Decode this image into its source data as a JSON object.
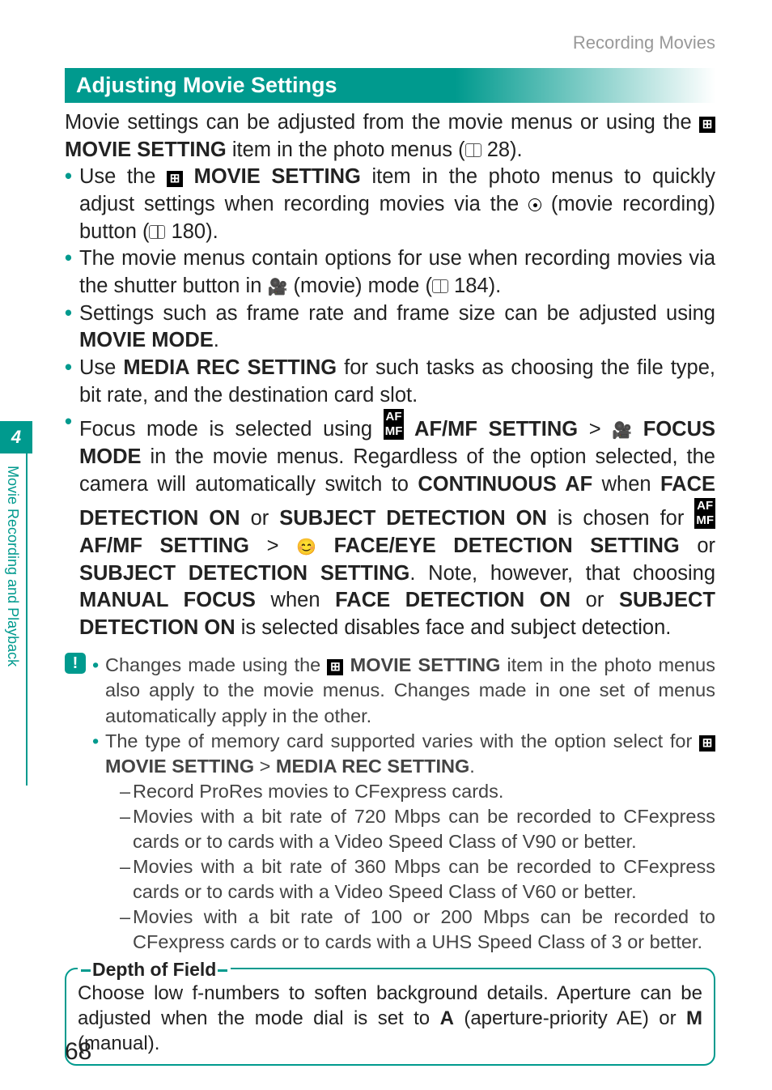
{
  "header": {
    "section": "Recording Movies"
  },
  "title": "Adjusting Movie Settings",
  "intro_a": "Movie settings can be adjusted from the movie menus or using the ",
  "intro_b": " MOVIE SETTING",
  "intro_c": " item in the photo menus (",
  "intro_d": " 28).",
  "b1a": "Use the ",
  "b1b": " MOVIE SETTING",
  "b1c": " item in the photo menus to quickly adjust settings when recording movies via the ",
  "b1d": " (movie recording) button (",
  "b1e": " 180).",
  "b2a": "The movie menus contain options for use when recording movies via the shutter button in ",
  "b2b": " (movie) mode (",
  "b2c": " 184).",
  "b3a": "Settings such as frame rate and frame size can be adjusted using ",
  "b3b": "MOVIE MODE",
  "b3c": ".",
  "b4a": "Use ",
  "b4b": "MEDIA REC SETTING",
  "b4c": " for such tasks as choosing the file type, bit rate, and the destination card slot.",
  "b5a": "Focus mode is selected using ",
  "b5b": " AF/MF SETTING",
  "b5c": " FOCUS MODE",
  "b5d": " in the movie menus. Regardless of the option selected, the camera will automatically switch to ",
  "b5e": "CONTINUOUS AF",
  "b5f": " when ",
  "b5g": "FACE DETECTION ON",
  "b5h": " or ",
  "b5i": "SUBJECT DETECTION ON",
  "b5j": " is chosen for ",
  "b5k": " AF/MF SETTING",
  "b5l": " FACE/EYE DETECTION SETTING",
  "b5m": " or ",
  "b5n": "SUBJECT DETECTION SETTING",
  "b5o": ". Note, however, that choosing ",
  "b5p": "MANUAL FOCUS",
  "b5q": " when ",
  "b5r": "FACE DETECTION ON",
  "b5s": " or ",
  "b5t": "SUBJECT DETECTION ON",
  "b5u": " is selected disables face and subject detection.",
  "n1a": "Changes made using the ",
  "n1b": " MOVIE SETTING",
  "n1c": " item in the photo menus also apply to the movie menus. Changes made in one set of menus automatically apply in the other.",
  "n2a": "The type of memory card supported varies with the option select for ",
  "n2b": " MOVIE SETTING",
  "n2c": "MEDIA REC SETTING",
  "n2d": ".",
  "s1": "Record ProRes movies to CFexpress cards.",
  "s2": "Movies with a bit rate of 720 Mbps can be recorded to CFexpress cards or to cards with a Video Speed Class of V90 or better.",
  "s3": "Movies with a bit rate of 360 Mbps can be recorded to CFexpress cards or to cards with a Video Speed Class of V60 or better.",
  "s4": "Movies with a bit rate of 100 or 200 Mbps can be recorded to CFexpress cards or to cards with a UHS Speed Class of 3 or better.",
  "dof": {
    "title": "Depth of Field",
    "a": "Choose low f-numbers to soften background details. Aperture can be adjusted when the mode dial is set to ",
    "b": "A",
    "c": " (aperture-priority AE) or ",
    "d": "M",
    "e": " (manual)."
  },
  "side": {
    "num": "4",
    "label": "Movie Recording and Playback"
  },
  "page_num": "68",
  "gt": " > ",
  "note_icon": "!"
}
